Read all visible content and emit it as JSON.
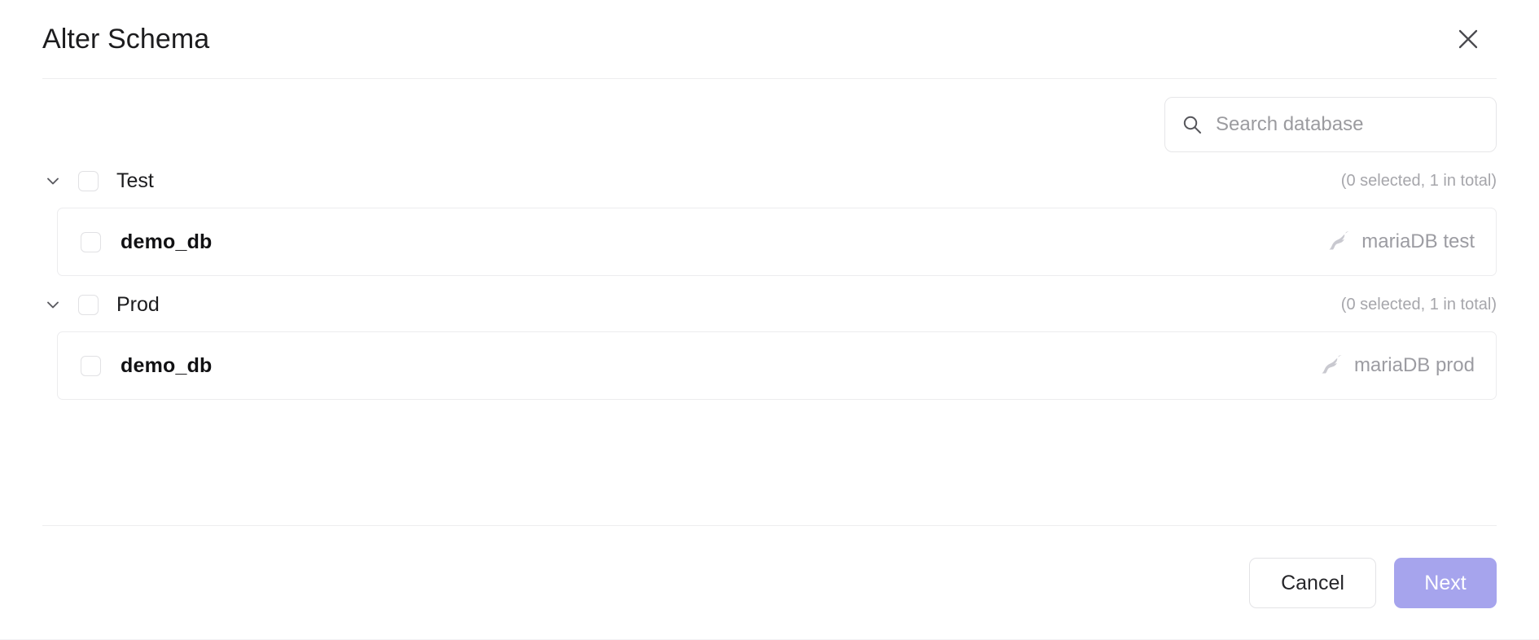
{
  "dialog": {
    "title": "Alter Schema",
    "close_icon": "close-icon"
  },
  "search": {
    "icon": "search-icon",
    "placeholder": "Search database",
    "value": ""
  },
  "groups": [
    {
      "name": "Test",
      "chevron_icon": "chevron-down-icon",
      "checked": false,
      "count_text": "(0 selected, 1 in total)",
      "databases": [
        {
          "name": "demo_db",
          "checked": false,
          "engine_icon": "mariadb-seal-icon",
          "engine_label": "mariaDB test"
        }
      ]
    },
    {
      "name": "Prod",
      "chevron_icon": "chevron-down-icon",
      "checked": false,
      "count_text": "(0 selected, 1 in total)",
      "databases": [
        {
          "name": "demo_db",
          "checked": false,
          "engine_icon": "mariadb-seal-icon",
          "engine_label": "mariaDB prod"
        }
      ]
    }
  ],
  "footer": {
    "cancel_label": "Cancel",
    "next_label": "Next",
    "next_color": "#a6a4ed",
    "next_disabled": true
  }
}
